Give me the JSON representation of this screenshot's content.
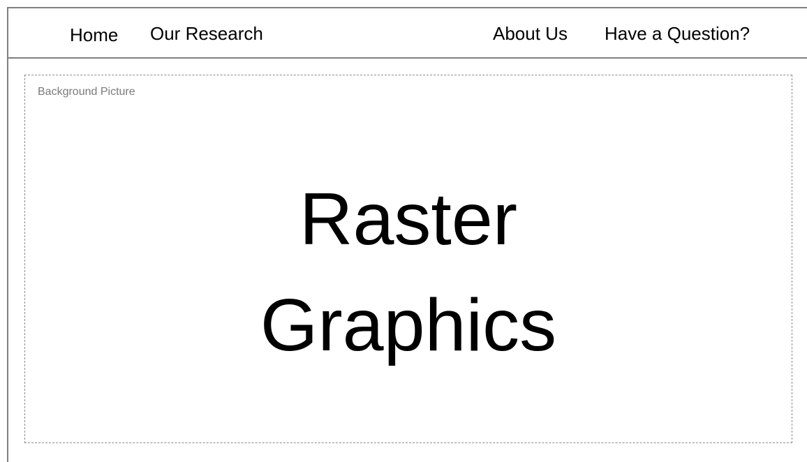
{
  "nav": {
    "home": "Home",
    "research": "Our Research",
    "about": "About Us",
    "question": "Have a Question?"
  },
  "hero": {
    "label": "Background Picture",
    "title_line1": "Raster",
    "title_line2": "Graphics"
  }
}
